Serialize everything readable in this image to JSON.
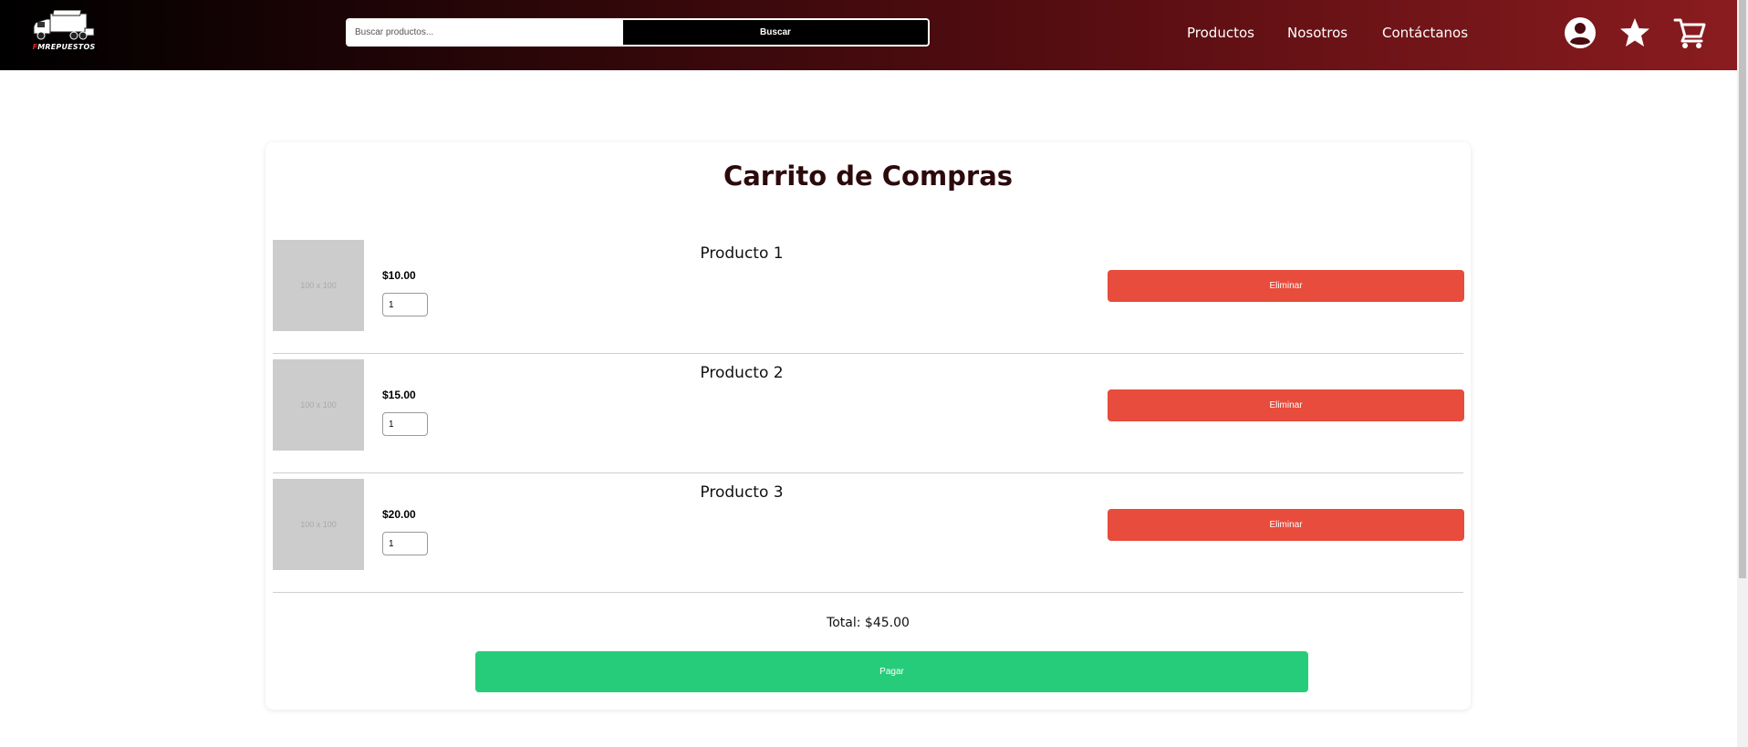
{
  "brand": {
    "logo_text_accent": "F",
    "logo_text": "MREPUESTOS"
  },
  "search": {
    "placeholder": "Buscar productos...",
    "button_label": "Buscar"
  },
  "nav": {
    "items": [
      "Productos",
      "Nosotros",
      "Contáctanos"
    ]
  },
  "header_icons": [
    "user-account-icon",
    "star-icon",
    "shopping-cart-icon"
  ],
  "cart": {
    "title": "Carrito de Compras",
    "items": [
      {
        "image_placeholder": "100 x 100",
        "name": "Producto 1",
        "price": "$10.00",
        "quantity": "1",
        "remove_label": "Eliminar"
      },
      {
        "image_placeholder": "100 x 100",
        "name": "Producto 2",
        "price": "$15.00",
        "quantity": "1",
        "remove_label": "Eliminar"
      },
      {
        "image_placeholder": "100 x 100",
        "name": "Producto 3",
        "price": "$20.00",
        "quantity": "1",
        "remove_label": "Eliminar"
      }
    ],
    "total_label": "Total: $45.00",
    "pay_label": "Pagar"
  },
  "colors": {
    "header_gradient_start": "#000000",
    "header_gradient_end": "#8a1c1f",
    "remove_button": "#e74c3c",
    "pay_button": "#27cc7a",
    "title": "#2c0a0c"
  }
}
